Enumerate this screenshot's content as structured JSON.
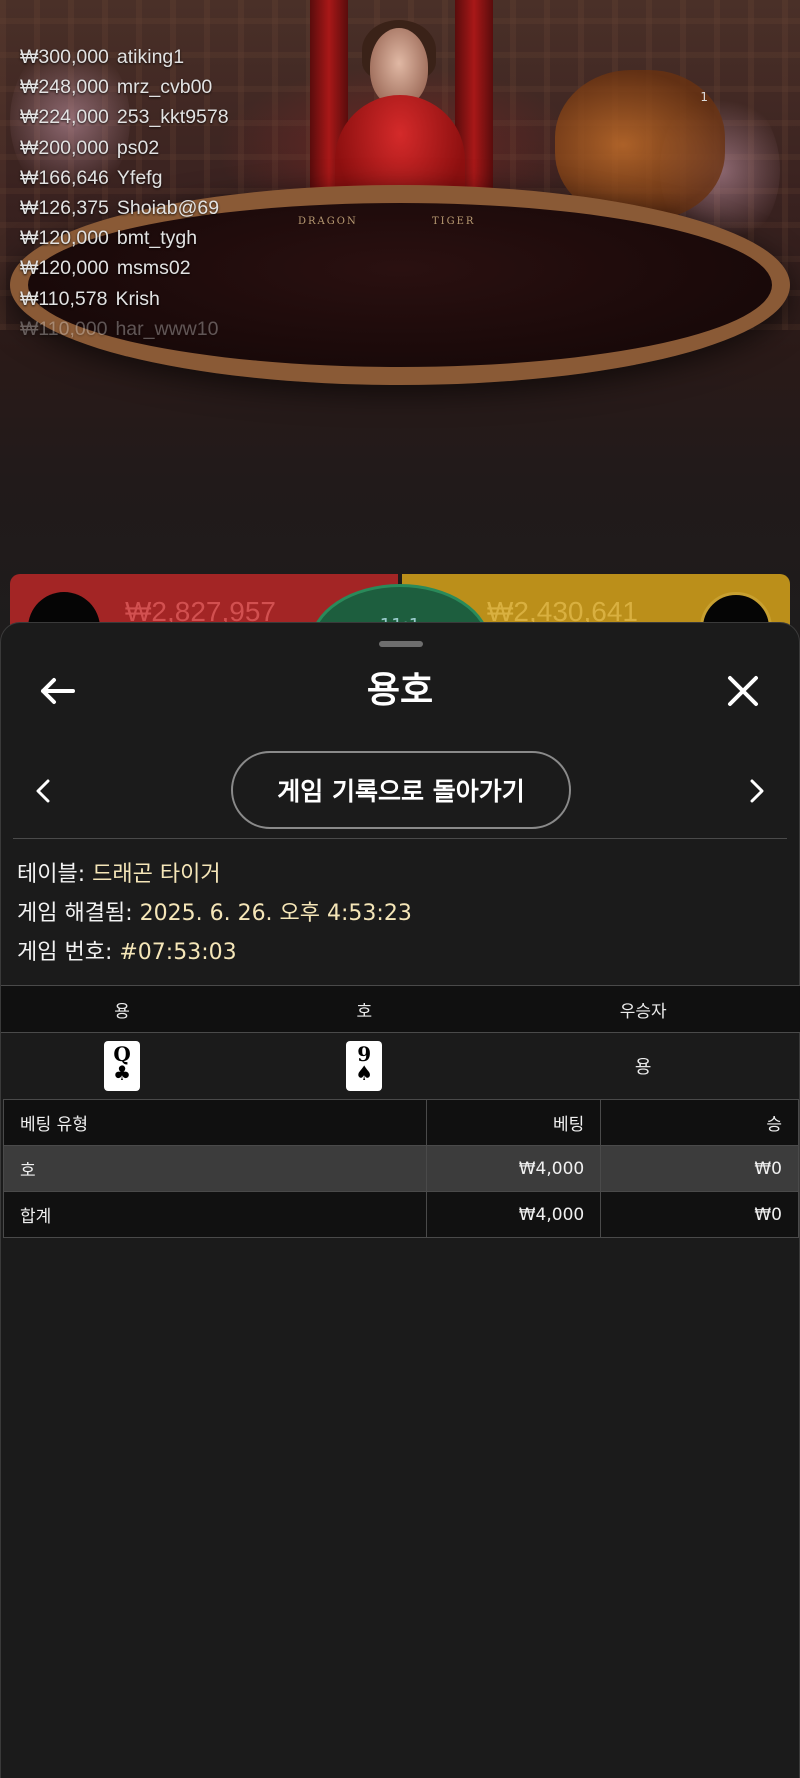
{
  "video": {
    "table_labels": {
      "left": "DRAGON",
      "right": "TIGER"
    },
    "counter": "1",
    "leaderboard": [
      {
        "amount": "₩300,000",
        "user": "atiking1"
      },
      {
        "amount": "₩248,000",
        "user": "mrz_cvb00"
      },
      {
        "amount": "₩224,000",
        "user": "253_kkt9578"
      },
      {
        "amount": "₩200,000",
        "user": "ps02"
      },
      {
        "amount": "₩166,646",
        "user": "Yfefg"
      },
      {
        "amount": "₩126,375",
        "user": "Shoiab@69"
      },
      {
        "amount": "₩120,000",
        "user": "bmt_tygh"
      },
      {
        "amount": "₩120,000",
        "user": "msms02"
      },
      {
        "amount": "₩110,578",
        "user": "Krish"
      },
      {
        "amount": "₩110,000",
        "user": "har_www10"
      }
    ],
    "bets": {
      "dragon_total": "₩2,827,957",
      "tiger_total": "₩2,430,641",
      "tie_ratio": "11:1"
    }
  },
  "sheet": {
    "title": "용호",
    "history_button": "게임 기록으로 돌아가기",
    "info": {
      "table_label": "테이블:",
      "table_value": "드래곤 타이거",
      "resolved_label": "게임 해결됨:",
      "resolved_value": "2025. 6. 26. 오후 4:53:23",
      "number_label": "게임 번호:",
      "number_value": "#07:53:03"
    },
    "results": {
      "headers": [
        "용",
        "호",
        "우승자"
      ],
      "dragon_card": {
        "rank": "Q",
        "suit": "♣"
      },
      "tiger_card": {
        "rank": "9",
        "suit": "♠"
      },
      "winner": "용"
    },
    "bets_table": {
      "headers": [
        "베팅 유형",
        "베팅",
        "승"
      ],
      "rows": [
        {
          "type": "호",
          "bet": "₩4,000",
          "win": "₩0"
        }
      ],
      "total": {
        "type": "합계",
        "bet": "₩4,000",
        "win": "₩0"
      }
    }
  },
  "colors": {
    "sheet_bg": "#1b1b1b",
    "value_text": "#f5e6b8",
    "dragon": "#a32525",
    "tiger": "#bb8f1a",
    "tie": "#1d5e3e"
  },
  "icons": {
    "back": "arrow-left-icon",
    "close": "close-icon",
    "prev": "chevron-left-icon",
    "next": "chevron-right-icon"
  }
}
